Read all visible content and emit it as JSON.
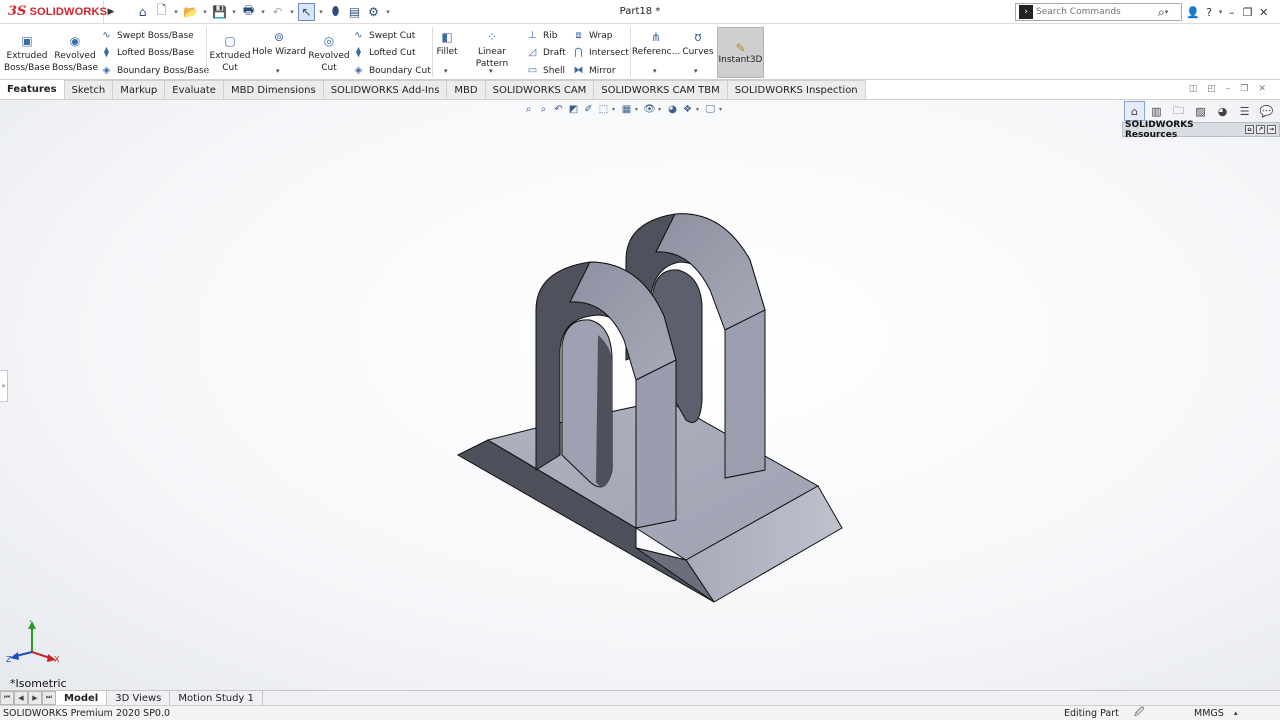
{
  "app": {
    "logo_text": "SOLIDWORKS",
    "logo_mark": "3S",
    "doc_title": "Part18 *"
  },
  "search": {
    "placeholder": "Search Commands"
  },
  "command_manager": {
    "extruded_boss": "Extruded Boss/Base",
    "revolved_boss": "Revolved Boss/Base",
    "swept_boss": "Swept Boss/Base",
    "lofted_boss": "Lofted Boss/Base",
    "boundary_boss": "Boundary Boss/Base",
    "extruded_cut": "Extruded Cut",
    "hole_wizard": "Hole Wizard",
    "revolved_cut": "Revolved Cut",
    "swept_cut": "Swept Cut",
    "lofted_cut": "Lofted Cut",
    "boundary_cut": "Boundary Cut",
    "fillet": "Fillet",
    "linear_pattern": "Linear Pattern",
    "rib": "Rib",
    "draft": "Draft",
    "shell": "Shell",
    "wrap": "Wrap",
    "intersect": "Intersect",
    "mirror": "Mirror",
    "reference": "Referenc...",
    "curves": "Curves",
    "instant3d": "Instant3D"
  },
  "tabs": [
    "Features",
    "Sketch",
    "Markup",
    "Evaluate",
    "MBD Dimensions",
    "SOLIDWORKS Add-Ins",
    "MBD",
    "SOLIDWORKS CAM",
    "SOLIDWORKS CAM TBM",
    "SOLIDWORKS Inspection"
  ],
  "task_pane": {
    "title": "SOLIDWORKS Resources"
  },
  "viewport": {
    "view_name": "*Isometric",
    "triad": {
      "y": "Y",
      "z": "Z",
      "x": "X"
    }
  },
  "bottom_tabs": [
    "Model",
    "3D Views",
    "Motion Study 1"
  ],
  "status": {
    "product": "SOLIDWORKS Premium 2020 SP0.0",
    "mode": "Editing Part",
    "units": "MMGS"
  },
  "colors": {
    "accent": "#d2232a",
    "part_face_light": "#a3a7b5",
    "part_face_mid": "#8f93a3",
    "part_face_dark": "#4a4c58"
  }
}
